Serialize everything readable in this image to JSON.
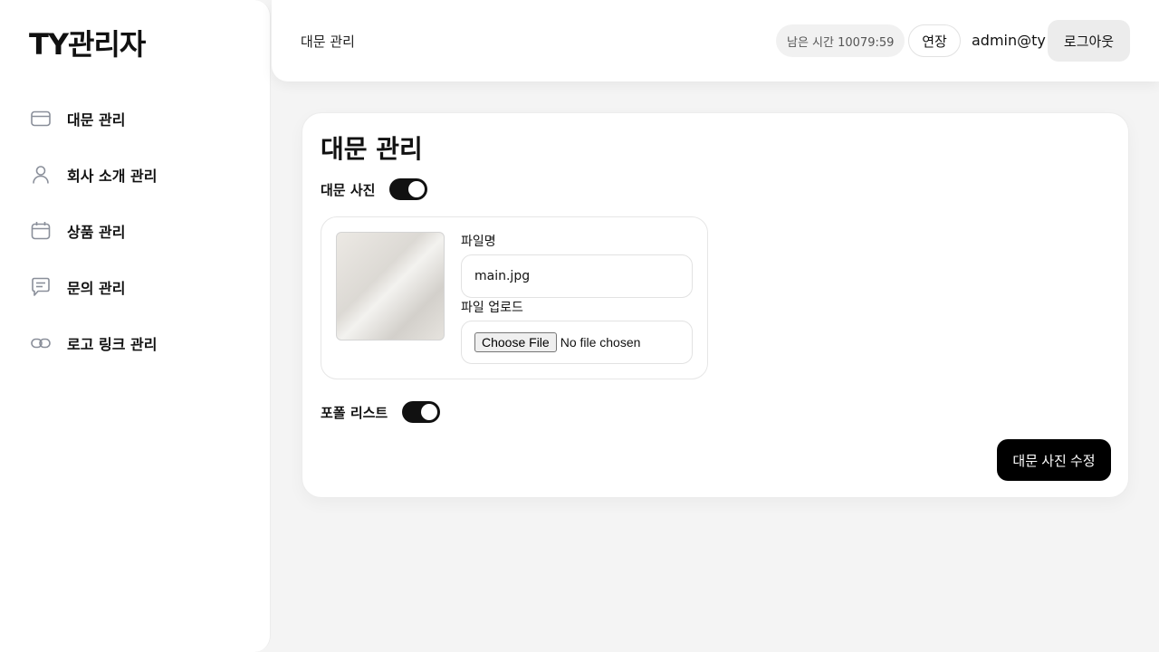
{
  "brand": {
    "title": "TY관리자"
  },
  "sidebar": {
    "items": [
      {
        "label": "대문 관리",
        "icon": "card-icon"
      },
      {
        "label": "회사 소개 관리",
        "icon": "user-icon"
      },
      {
        "label": "상품 관리",
        "icon": "calendar-icon"
      },
      {
        "label": "문의 관리",
        "icon": "message-icon"
      },
      {
        "label": "로고 링크 관리",
        "icon": "link-icon"
      }
    ]
  },
  "header": {
    "breadcrumb": "대문 관리",
    "timer": "남은 시간 10079:59",
    "extend_label": "연장",
    "user_email": "admin@ty",
    "logout_label": "로그아웃"
  },
  "main": {
    "title": "대문 관리",
    "main_photo_toggle": {
      "label": "대문 사진",
      "on": true
    },
    "upload": {
      "filename_label": "파일명",
      "filename_value": "main.jpg",
      "upload_label": "파일 업로드",
      "choose_file_label": "Choose File",
      "no_file_text": "No file chosen"
    },
    "portfolio_toggle": {
      "label": "포폴 리스트",
      "on": true
    },
    "submit_label": "대문 사진 수정"
  },
  "colors": {
    "accent": "#111111",
    "background": "#f4f4f4",
    "surface": "#ffffff"
  }
}
